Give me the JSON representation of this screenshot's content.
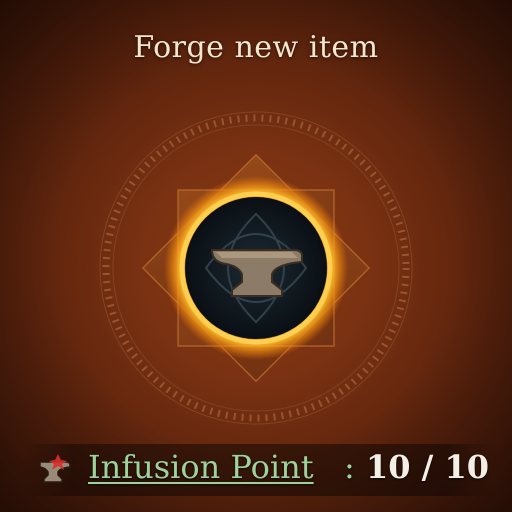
{
  "panel": {
    "title": "Forge new item"
  },
  "forge_button": {
    "icon": "anvil-icon"
  },
  "infusion": {
    "label": "Infusion Point",
    "separator": ":",
    "current": "10",
    "max": "10",
    "value_text": "10 / 10",
    "icon": "anvil-sparkle-icon"
  },
  "colors": {
    "background": "#7a3212",
    "glow": "#ffb020",
    "title_text": "#f3e6cf",
    "label_green": "#9fd19a"
  }
}
